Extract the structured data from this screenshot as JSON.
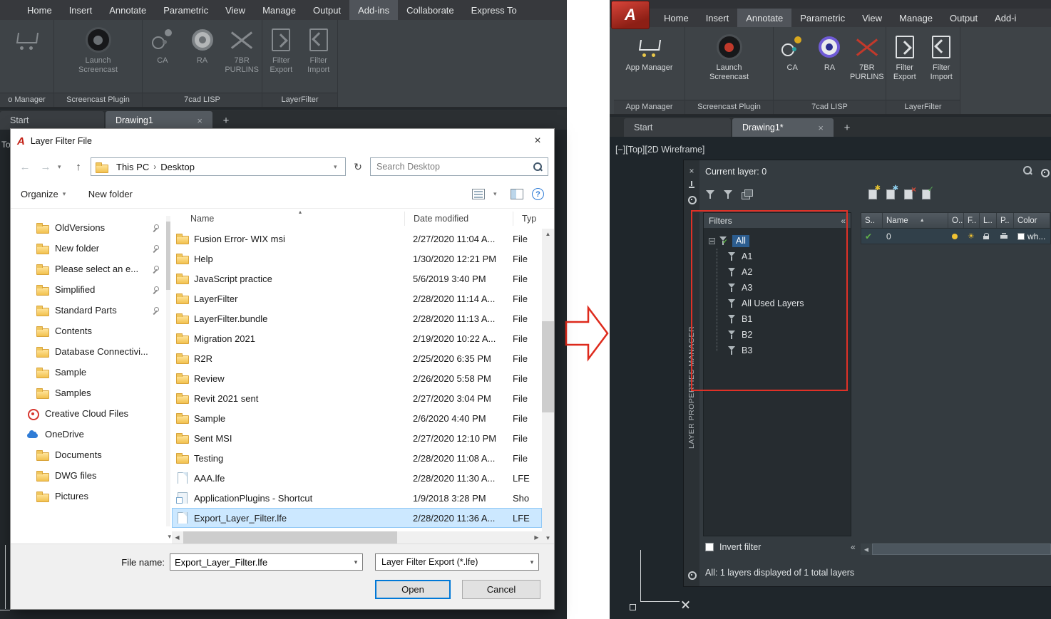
{
  "left_window": {
    "menu_tabs": [
      {
        "label": "Home"
      },
      {
        "label": "Insert"
      },
      {
        "label": "Annotate"
      },
      {
        "label": "Parametric"
      },
      {
        "label": "View"
      },
      {
        "label": "Manage"
      },
      {
        "label": "Output"
      },
      {
        "label": "Add-ins",
        "active": true
      },
      {
        "label": "Collaborate"
      },
      {
        "label": "Express To"
      }
    ],
    "ribbon": {
      "launch1": "Launch",
      "launch2": "Screencast",
      "ca": "CA",
      "ra": "RA",
      "purlins1": "7BR",
      "purlins2": "PURLINS",
      "fexp1": "Filter",
      "fexp2": "Export",
      "fimp1": "Filter",
      "fimp2": "Import",
      "panels": [
        "o Manager",
        "Screencast Plugin",
        "7cad LISP",
        "LayerFilter"
      ]
    },
    "doc_tabs": {
      "start": "Start",
      "drawing": "Drawing1",
      "new_tab": "+"
    },
    "clipped_text": "To"
  },
  "dialog": {
    "title": "Layer Filter File",
    "nav": {
      "breadcrumb_root": "This PC",
      "breadcrumb_folder": "Desktop",
      "search_placeholder": "Search Desktop"
    },
    "toolbar": {
      "organize": "Organize",
      "new_folder": "New folder"
    },
    "sidebar_items": [
      {
        "icon": "folder",
        "label": "OldVersions",
        "pin": true,
        "ind": "lvl2"
      },
      {
        "icon": "folder",
        "label": "New folder",
        "pin": true,
        "ind": "lvl2"
      },
      {
        "icon": "folder",
        "label": "Please select an e...",
        "pin": true,
        "ind": "lvl2"
      },
      {
        "icon": "folder",
        "label": "Simplified",
        "pin": true,
        "ind": "lvl2"
      },
      {
        "icon": "folder",
        "label": "Standard Parts",
        "pin": true,
        "ind": "lvl2"
      },
      {
        "icon": "folder",
        "label": "Contents",
        "ind": "lvl2"
      },
      {
        "icon": "folder",
        "label": "Database Connectivi...",
        "ind": "lvl2"
      },
      {
        "icon": "folder",
        "label": "Sample",
        "ind": "lvl2"
      },
      {
        "icon": "folder",
        "label": "Samples",
        "ind": "lvl2"
      },
      {
        "icon": "cc",
        "label": "Creative Cloud Files",
        "ind": "lvl1"
      },
      {
        "icon": "cloud",
        "label": "OneDrive",
        "ind": "lvl1"
      },
      {
        "icon": "folder",
        "label": "Documents",
        "ind": "lvl2"
      },
      {
        "icon": "folder",
        "label": "DWG files",
        "ind": "lvl2"
      },
      {
        "icon": "folder",
        "label": "Pictures",
        "ind": "lvl2"
      }
    ],
    "columns": {
      "name": "Name",
      "date": "Date modified",
      "type": "Typ"
    },
    "files": [
      {
        "icon": "folder",
        "name": "Fusion Error- WIX msi",
        "date": "2/27/2020 11:04 A...",
        "type": "File"
      },
      {
        "icon": "folder",
        "name": "Help",
        "date": "1/30/2020 12:21 PM",
        "type": "File"
      },
      {
        "icon": "folder",
        "name": "JavaScript practice",
        "date": "5/6/2019 3:40 PM",
        "type": "File"
      },
      {
        "icon": "folder",
        "name": "LayerFilter",
        "date": "2/28/2020 11:14 A...",
        "type": "File"
      },
      {
        "icon": "folder",
        "name": "LayerFilter.bundle",
        "date": "2/28/2020 11:13 A...",
        "type": "File"
      },
      {
        "icon": "folder",
        "name": "Migration 2021",
        "date": "2/19/2020 10:22 A...",
        "type": "File"
      },
      {
        "icon": "folder",
        "name": "R2R",
        "date": "2/25/2020 6:35 PM",
        "type": "File"
      },
      {
        "icon": "folder",
        "name": "Review",
        "date": "2/26/2020 5:58 PM",
        "type": "File"
      },
      {
        "icon": "folder",
        "name": "Revit 2021 sent",
        "date": "2/27/2020 3:04 PM",
        "type": "File"
      },
      {
        "icon": "folder",
        "name": "Sample",
        "date": "2/6/2020 4:40 PM",
        "type": "File"
      },
      {
        "icon": "folder",
        "name": "Sent MSI",
        "date": "2/27/2020 12:10 PM",
        "type": "File"
      },
      {
        "icon": "folder",
        "name": "Testing",
        "date": "2/28/2020 11:08 A...",
        "type": "File"
      },
      {
        "icon": "file",
        "name": "AAA.lfe",
        "date": "2/28/2020 11:30 A...",
        "type": "LFE"
      },
      {
        "icon": "shortcut",
        "name": "ApplicationPlugins - Shortcut",
        "date": "1/9/2018 3:28 PM",
        "type": "Sho"
      },
      {
        "icon": "file",
        "name": "Export_Layer_Filter.lfe",
        "date": "2/28/2020 11:36 A...",
        "type": "LFE",
        "selected": true
      }
    ],
    "footer": {
      "file_name_label": "File name:",
      "file_name_value": "Export_Layer_Filter.lfe",
      "file_type_value": "Layer Filter Export (*.lfe)",
      "open": "Open",
      "cancel": "Cancel"
    }
  },
  "right_window": {
    "menu_tabs": [
      {
        "label": "Home"
      },
      {
        "label": "Insert"
      },
      {
        "label": "Annotate",
        "active": true
      },
      {
        "label": "Parametric"
      },
      {
        "label": "View"
      },
      {
        "label": "Manage"
      },
      {
        "label": "Output"
      },
      {
        "label": "Add-i"
      }
    ],
    "ribbon": {
      "app_manager": "App Manager",
      "launch1": "Launch",
      "launch2": "Screencast",
      "ca": "CA",
      "ra": "RA",
      "purlins1": "7BR",
      "purlins2": "PURLINS",
      "fexp1": "Filter",
      "fexp2": "Export",
      "fimp1": "Filter",
      "fimp2": "Import",
      "panels": [
        "App Manager",
        "Screencast Plugin",
        "7cad LISP",
        "LayerFilter"
      ]
    },
    "doc_tabs": {
      "start": "Start",
      "drawing": "Drawing1*",
      "new_tab": "+"
    },
    "viewport_label": "[−][Top][2D Wireframe]",
    "palette": {
      "title": "LAYER PROPERTIES MANAGER",
      "current_layer": "Current layer: 0",
      "filters_header": "Filters",
      "tree_root": "All",
      "tree_children": [
        "A1",
        "A2",
        "A3",
        "All Used Layers",
        "B1",
        "B2",
        "B3"
      ],
      "grid_columns": [
        "S..",
        "Name",
        "O..",
        "F..",
        "L..",
        "P..",
        "Color"
      ],
      "layer_row": {
        "name": "0",
        "color_label": "wh..."
      },
      "invert_filter_label": "Invert filter",
      "status": "All: 1 layers displayed of 1 total layers"
    }
  }
}
